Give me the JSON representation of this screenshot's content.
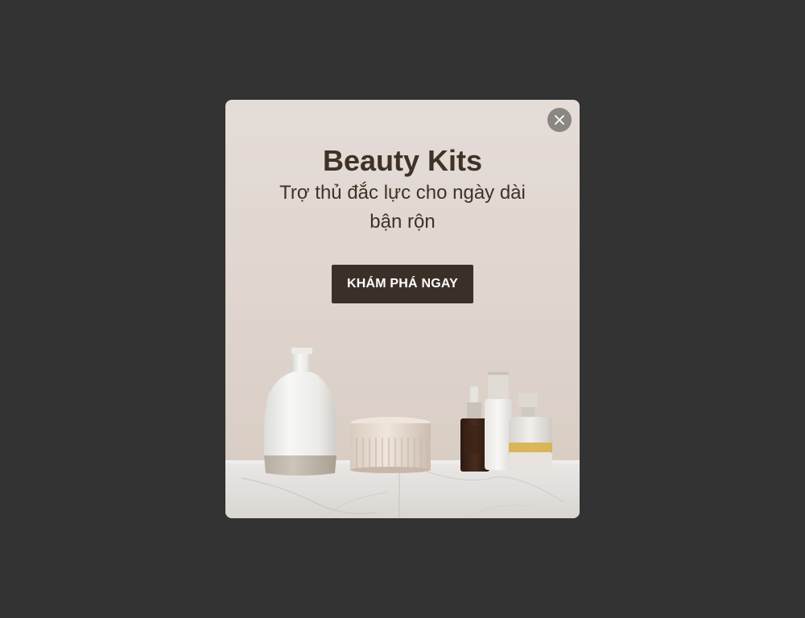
{
  "popup": {
    "title": "Beauty Kits",
    "subtitle": "Trợ thủ đắc lực cho ngày dài bận rộn",
    "cta_label": "KHÁM PHÁ NGAY",
    "close_icon": "close-icon"
  },
  "colors": {
    "overlay": "#333333",
    "title_text": "#3f3227",
    "cta_background": "#3b3028",
    "cta_text": "#ffffff",
    "close_button": "#8a8682"
  }
}
